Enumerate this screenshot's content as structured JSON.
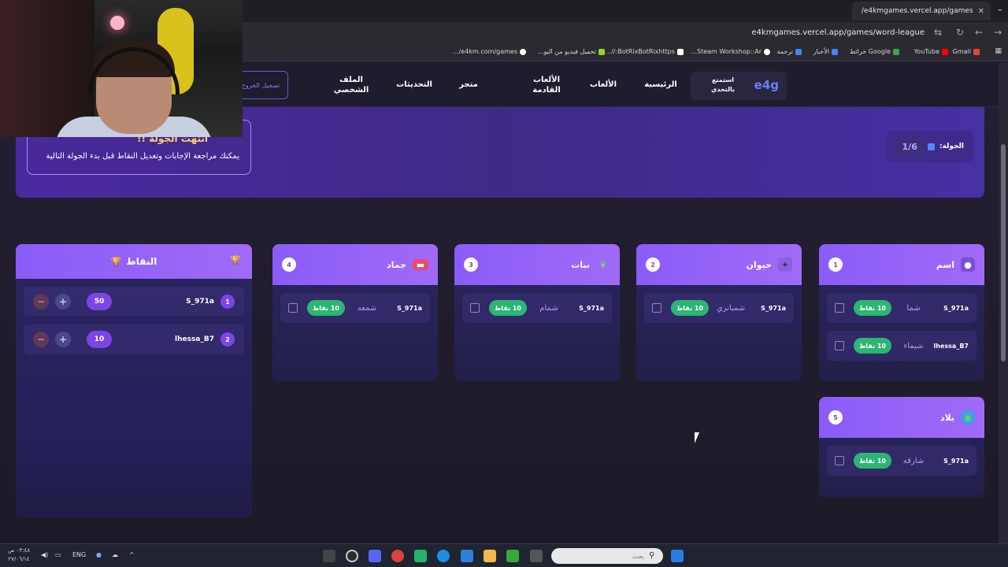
{
  "browser": {
    "tab_title": "e4kmgames.vercel.app/games/",
    "url": "e4kmgames.vercel.app/games/word-league",
    "bookmarks": [
      "Gmail",
      "YouTube",
      "Google خرائط",
      "الأخبار",
      "ترجمة",
      "Steam Workshop::Ar...",
      "BotRixBotRixhttps://...",
      "تحميل فيديو من اليو...",
      "e4km.com/games/..."
    ]
  },
  "site": {
    "brand_logo": "e4g",
    "brand_tag": "استمتع بالتحدي",
    "nav": [
      "الرئيسية",
      "الألعاب",
      "الألعاب القادمة",
      "متجر",
      "التحديثات",
      "الملف الشخصي"
    ],
    "logout": "تسجيل الخروج"
  },
  "round": {
    "label": "الجولة:",
    "value": "1/6",
    "notice_title": "انتهت الجولة !!",
    "notice_text": "يمكنك مراجعة الإجابات وتعديل النقاط قبل بدء الجولة التالية"
  },
  "categories": [
    {
      "num": "1",
      "title": "اسم",
      "icon": "person-icon",
      "answers": [
        {
          "user": "S_971a",
          "word": "شما",
          "points": "10 نقاط"
        },
        {
          "user": "lhessa_B7",
          "word": "شيماء",
          "points": "10 نقاط"
        }
      ]
    },
    {
      "num": "2",
      "title": "حيوان",
      "icon": "paw-icon",
      "answers": [
        {
          "user": "S_971a",
          "word": "شمبانزي",
          "points": "10 نقاط"
        }
      ]
    },
    {
      "num": "3",
      "title": "نبات",
      "icon": "leaf-icon",
      "answers": [
        {
          "user": "S_971a",
          "word": "شمام",
          "points": "10 نقاط"
        }
      ]
    },
    {
      "num": "4",
      "title": "جماد",
      "icon": "box-icon",
      "answers": [
        {
          "user": "S_971a",
          "word": "شمعه",
          "points": "10 نقاط"
        }
      ]
    },
    {
      "num": "5",
      "title": "بلاد",
      "icon": "globe-icon",
      "answers": [
        {
          "user": "S_971a",
          "word": "شارقه",
          "points": "10 نقاط"
        }
      ]
    }
  ],
  "points": {
    "title": "النقاط",
    "rows": [
      {
        "rank": "1",
        "name": "S_971a",
        "score": "50"
      },
      {
        "rank": "2",
        "name": "lhessa_B7",
        "score": "10"
      }
    ]
  },
  "taskbar": {
    "search_placeholder": "بحث",
    "lang": "ENG",
    "time": "٠٣:٤٨ ص",
    "date": "٢٧/٠٦/١٤"
  }
}
